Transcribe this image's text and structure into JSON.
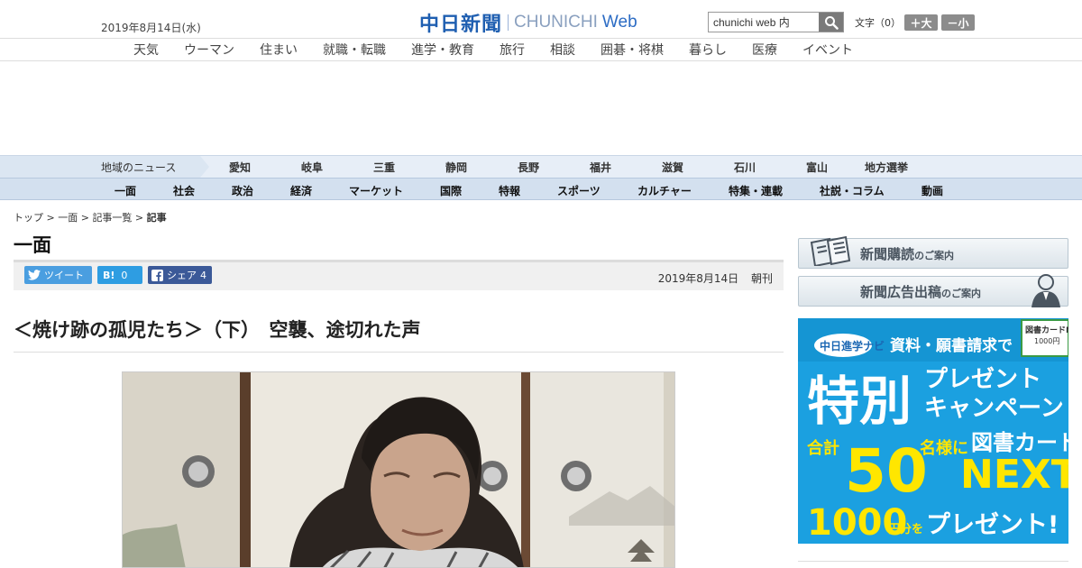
{
  "header": {
    "date": "2019年8月14日(水)",
    "logo_jp": "中日新聞",
    "logo_en": "CHUNICHI",
    "logo_web": "Web",
    "search_value": "chunichi web 内",
    "font_label": "文字（0）",
    "font_larger": "＋大",
    "font_smaller": "－小"
  },
  "nav_primary": [
    "天気",
    "ウーマン",
    "住まい",
    "就職・転職",
    "進学・教育",
    "旅行",
    "相談",
    "囲碁・将棋",
    "暮らし",
    "医療",
    "イベント"
  ],
  "nav_regions": {
    "label": "地域のニュース",
    "items": [
      "愛知",
      "岐阜",
      "三重",
      "静岡",
      "長野",
      "福井",
      "滋賀",
      "石川",
      "富山",
      "地方選挙"
    ]
  },
  "nav_sections": [
    "一面",
    "社会",
    "政治",
    "経済",
    "マーケット",
    "国際",
    "特報",
    "スポーツ",
    "カルチャー",
    "特集・連載",
    "社説・コラム",
    "動画"
  ],
  "breadcrumb": [
    "トップ",
    "一面",
    "記事一覧",
    "記事"
  ],
  "breadcrumb_sep": " > ",
  "section_title": "一面",
  "share": {
    "tweet": "ツイート",
    "hatena_mark": "B!",
    "hatena_count": "0",
    "facebook": "シェア",
    "facebook_count": "4"
  },
  "publication": {
    "date": "2019年8月14日",
    "edition": "朝刊"
  },
  "article": {
    "headline": "＜焼け跡の孤児たち＞（下）　空襲、途切れた声"
  },
  "sidebar": {
    "subscribe": {
      "main": "新聞購読",
      "sub": "のご案内"
    },
    "advertise": {
      "main": "新聞広告出稿",
      "sub": "のご案内"
    },
    "promo": {
      "brand": "中日進学ナビ",
      "line1": "資料・願書請求で",
      "special": "特別",
      "line2a": "プレゼント",
      "line2b": "キャンペーン",
      "total": "合計",
      "count": "50",
      "people": "名様に",
      "card": "図書カード",
      "next": "NEXT",
      "amount": "1000",
      "amount_suffix": "円分を",
      "present": "プレゼント!",
      "card_tag": "図書カードNEXT",
      "card_value": "1000円"
    }
  },
  "colors": {
    "logo_blue": "#1f5fb1",
    "region_bar": "#e7eef7",
    "section_bar": "#d3e0ef",
    "twitter": "#4a9ee0",
    "hatena": "#2e9de2",
    "facebook": "#3b5998",
    "promo_blue": "#1ba0e0",
    "promo_yellow": "#ffe600"
  }
}
